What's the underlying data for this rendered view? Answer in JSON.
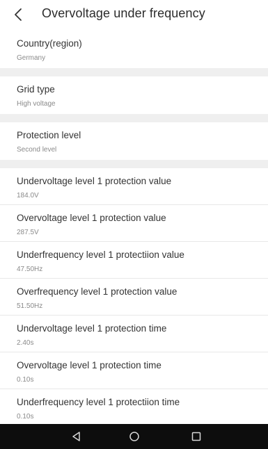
{
  "header": {
    "title": "Overvoltage under frequency",
    "back_icon": "chevron-left-icon"
  },
  "settings": [
    {
      "label": "Country(region)",
      "value": "Germany"
    },
    {
      "label": "Grid type",
      "value": "High voltage"
    },
    {
      "label": "Protection level",
      "value": "Second level"
    }
  ],
  "parameters": [
    {
      "label": "Undervoltage level 1 protection value",
      "value": "184.0V"
    },
    {
      "label": "Overvoltage level 1 protection value",
      "value": "287.5V"
    },
    {
      "label": "Underfrequency level 1 protectiion value",
      "value": "47.50Hz"
    },
    {
      "label": "Overfrequency level 1 protection value",
      "value": "51.50Hz"
    },
    {
      "label": "Undervoltage level 1 protection time",
      "value": "2.40s"
    },
    {
      "label": "Overvoltage level 1 protection time",
      "value": "0.10s"
    },
    {
      "label": "Underfrequency level 1 protectiion time",
      "value": "0.10s"
    }
  ],
  "navbar": {
    "icons": [
      "back-triangle-icon",
      "home-circle-icon",
      "recents-square-icon"
    ],
    "color": "#0d0d0d"
  }
}
